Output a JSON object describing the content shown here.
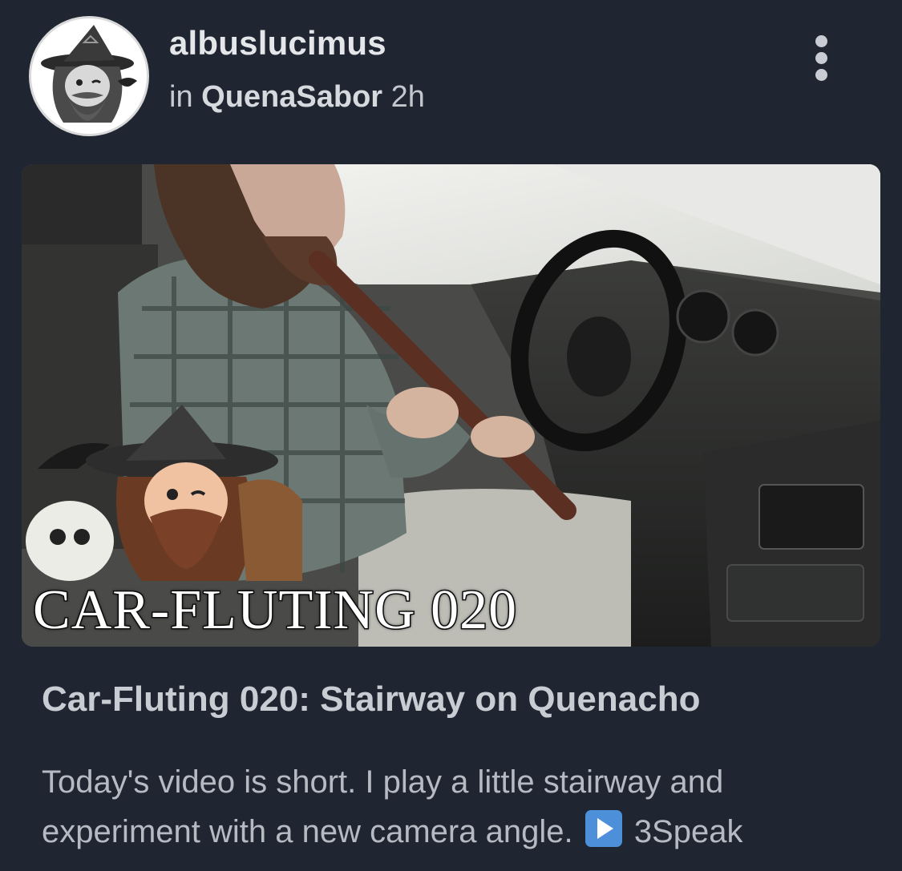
{
  "post": {
    "author": "albuslucimus",
    "in_label": "in",
    "community": "QuenaSabor",
    "time": "2h",
    "avatar_icon": "wizard-avatar-icon",
    "more_icon": "more-vertical-icon",
    "thumbnail": {
      "caption": "CAR-FLUTING 020"
    },
    "title": "Car-Fluting 020: Stairway on Quenacho",
    "body_text": "Today's video is short. I play a little stairway and experiment with a new camera angle.",
    "link_icon": "play-button-icon",
    "link_label": "3Speak"
  },
  "colors": {
    "background": "#1f2631",
    "author_text": "#e4e6ea",
    "title_text": "#c8ccd3",
    "body_text": "#b6bbc3",
    "play_icon": "#4d8fd8"
  }
}
